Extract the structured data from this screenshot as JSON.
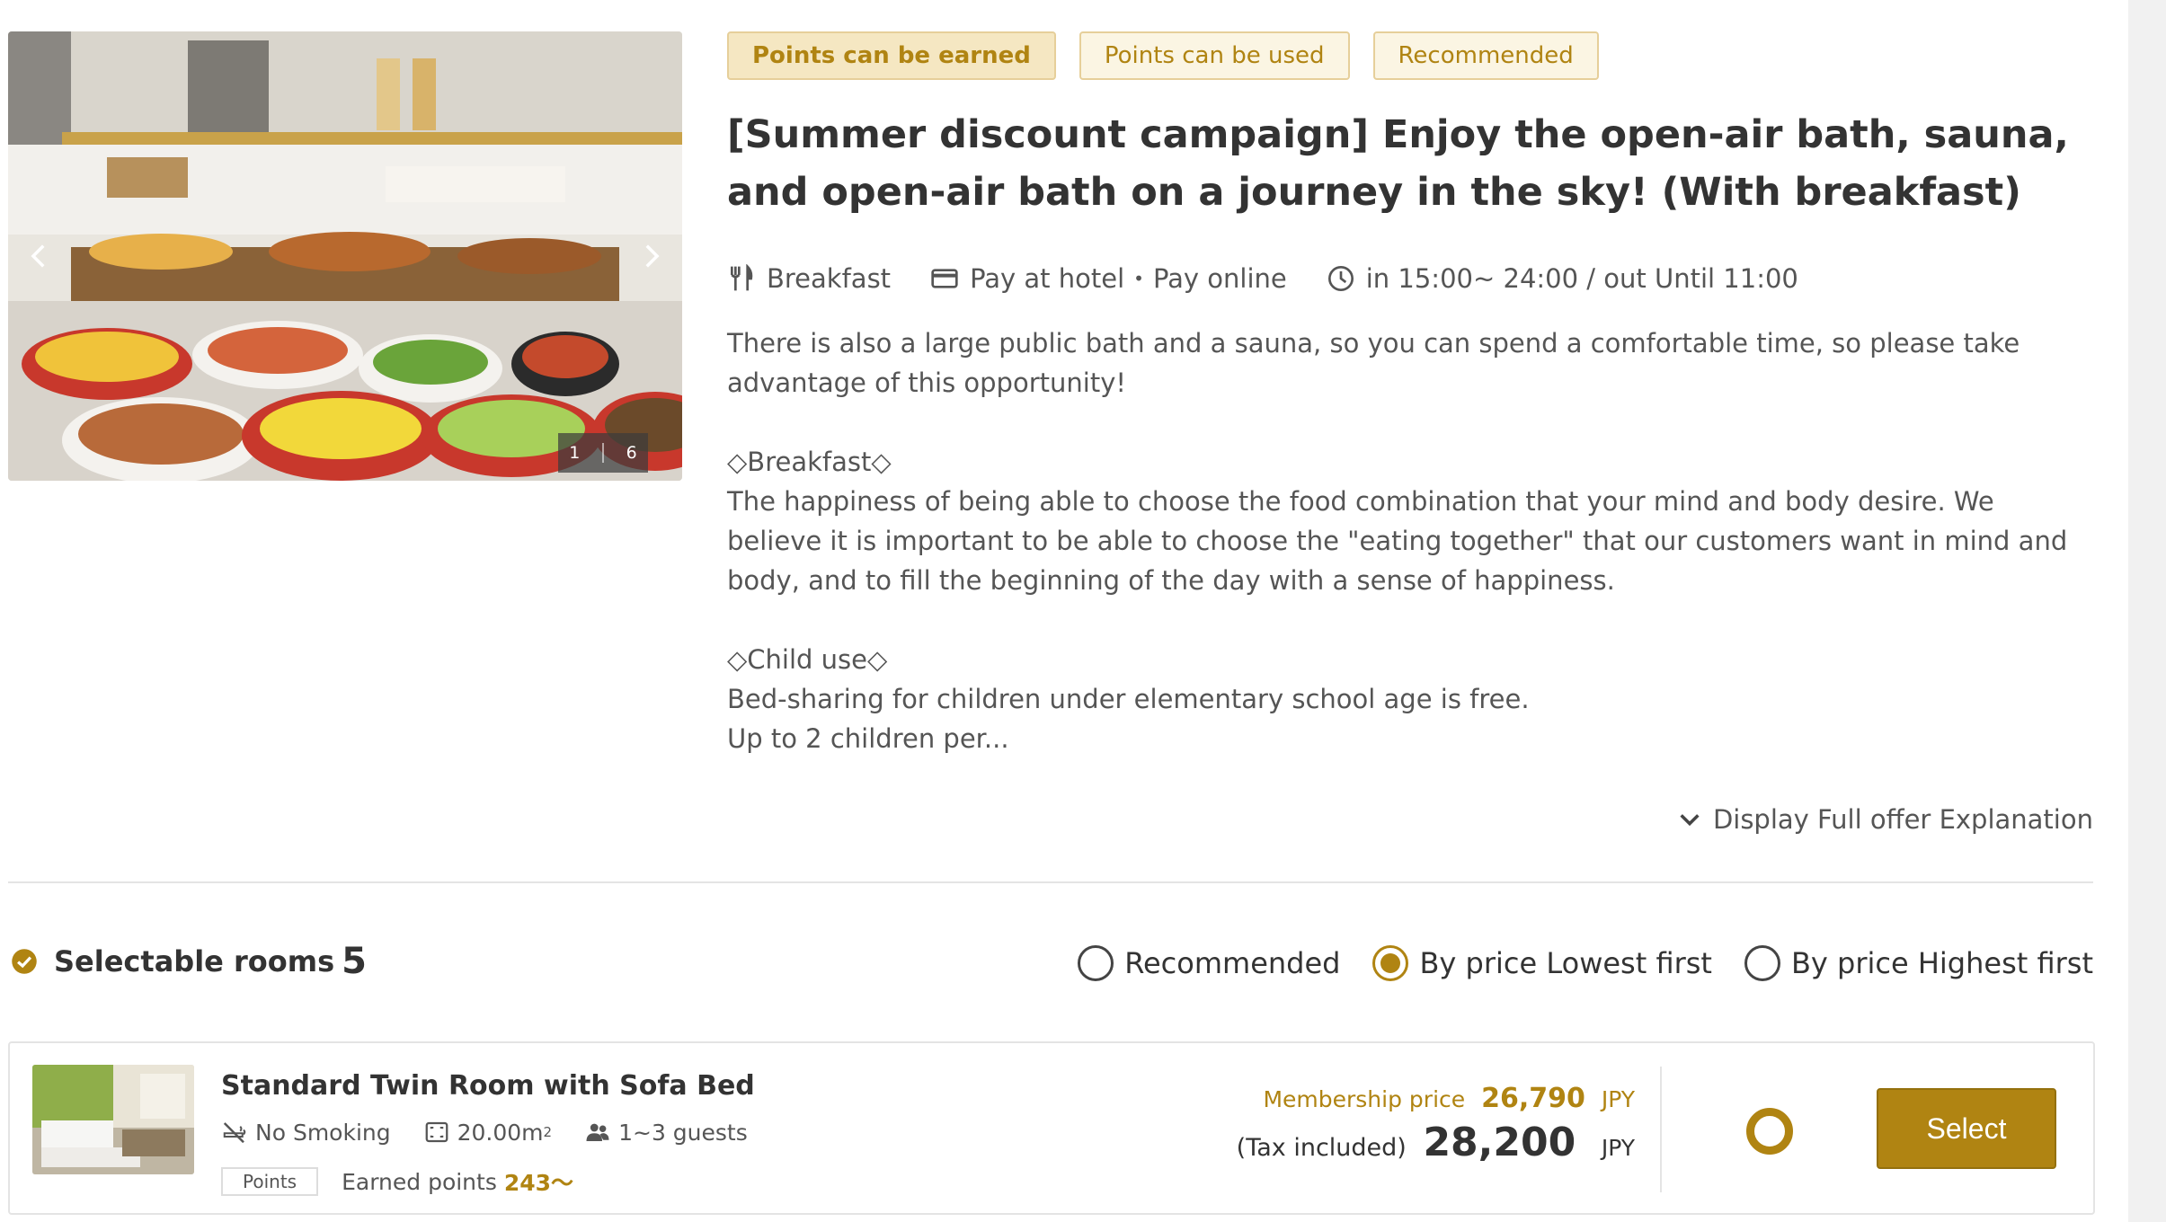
{
  "gallery": {
    "current": "1",
    "total": "6"
  },
  "badges": [
    "Points can be earned",
    "Points can be used",
    "Recommended"
  ],
  "plan": {
    "title": "[Summer discount campaign] Enjoy the open-air bath, sauna, and open-air bath on a journey in the sky! (With breakfast)",
    "meal": "Breakfast",
    "payment_hotel": "Pay at hotel",
    "payment_sep": "•",
    "payment_online": "Pay online",
    "checkin": "in 15:00~ 24:00 / out Until 11:00"
  },
  "description": {
    "intro": "There is also a large public bath and a sauna, so you can spend a comfortable time, so please take advantage of this opportunity!",
    "breakfast_head": "◇Breakfast◇",
    "breakfast_text": "The happiness of being able to choose the food combination that your mind and body desire. We believe it is important to be able to choose the \"eating together\" that our customers want in mind and body, and to fill the beginning of the day with a sense of happiness.",
    "child_head": "◇Child use◇",
    "child_line1": "Bed-sharing for children under elementary school age is free.",
    "child_line2": "Up to 2 children per..."
  },
  "full_explanation_link": "Display Full offer Explanation",
  "rooms": {
    "label": "Selectable rooms",
    "count": "5",
    "sort_options": [
      "Recommended",
      "By price Lowest first",
      "By price Highest first"
    ],
    "sort_selected": "By price Lowest first"
  },
  "room": {
    "name": "Standard Twin Room with Sofa Bed",
    "smoking": "No Smoking",
    "size": "20.00m",
    "size_sup": "2",
    "guests": "1~3 guests",
    "points_tag": "Points",
    "earned_label": "Earned points",
    "earned_value": "243〜",
    "member_label": "Membership price",
    "member_price": "26,790",
    "member_currency": "JPY",
    "tax_label": "(Tax included)",
    "price": "28,200",
    "currency": "JPY",
    "select_label": "Select"
  },
  "colors": {
    "accent": "#b08412",
    "badge_bg": "#fbf5e3",
    "badge_border": "#e6cf9a"
  }
}
